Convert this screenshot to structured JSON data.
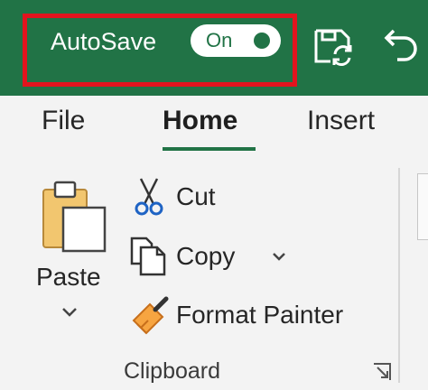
{
  "titlebar": {
    "autosave_label": "AutoSave",
    "autosave_state": "On",
    "autosave_on": true,
    "save_icon": "save-refresh-icon",
    "undo_icon": "undo-icon"
  },
  "tabs": [
    {
      "label": "File",
      "active": false
    },
    {
      "label": "Home",
      "active": true
    },
    {
      "label": "Insert",
      "active": false
    }
  ],
  "clipboard": {
    "paste_label": "Paste",
    "cut_label": "Cut",
    "copy_label": "Copy",
    "format_painter_label": "Format Painter",
    "group_label": "Clipboard"
  },
  "colors": {
    "titlebar": "#217346",
    "highlight": "#e2141e",
    "ribbon": "#f3f3f3"
  }
}
